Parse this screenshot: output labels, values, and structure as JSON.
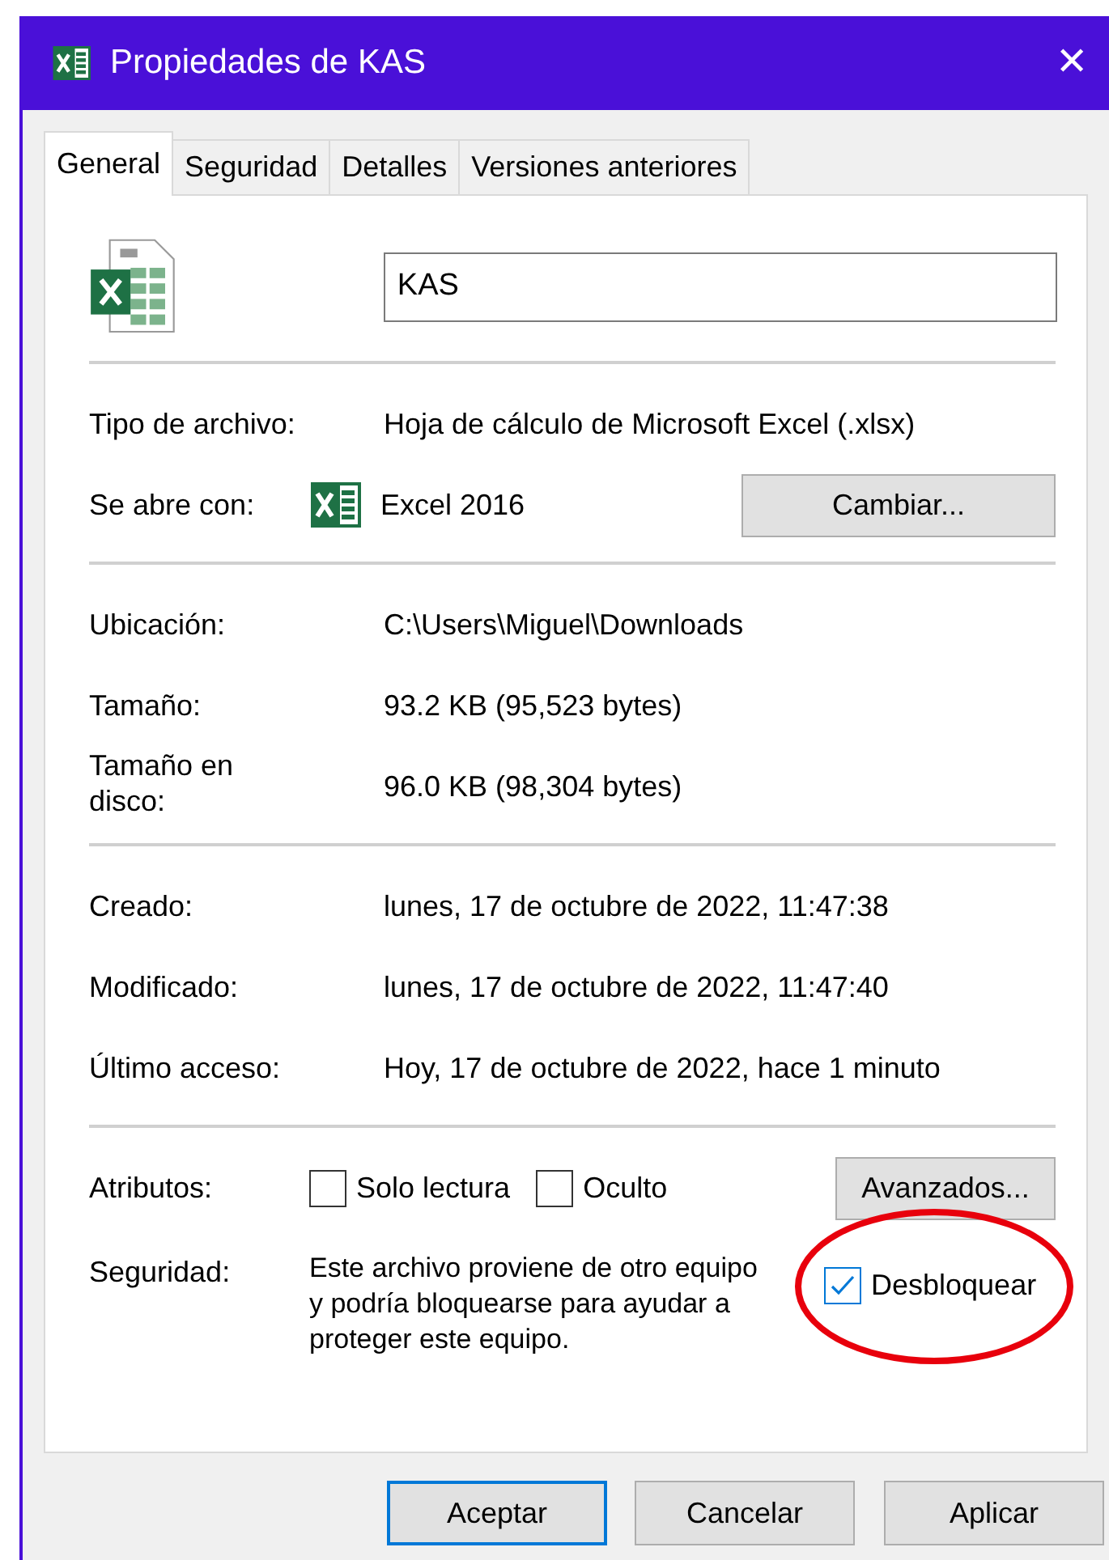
{
  "window": {
    "title": "Propiedades de KAS",
    "close": "✕"
  },
  "tabs": [
    {
      "label": "General",
      "selected": true
    },
    {
      "label": "Seguridad",
      "selected": false
    },
    {
      "label": "Detalles",
      "selected": false
    },
    {
      "label": "Versiones anteriores",
      "selected": false
    }
  ],
  "name_field": {
    "value": "KAS"
  },
  "sections": [
    [
      {
        "kind": "text",
        "label": "Tipo de archivo:",
        "value": "Hoja de cálculo de Microsoft Excel (.xlsx)"
      },
      {
        "kind": "app",
        "label": "Se abre con:",
        "value": "Excel 2016",
        "button": "Cambiar..."
      }
    ],
    [
      {
        "kind": "text",
        "label": "Ubicación:",
        "value": "C:\\Users\\Miguel\\Downloads"
      },
      {
        "kind": "text",
        "label": "Tamaño:",
        "value": "93.2 KB (95,523 bytes)"
      },
      {
        "kind": "text",
        "label": "Tamaño en disco:",
        "value": "96.0 KB (98,304 bytes)"
      }
    ],
    [
      {
        "kind": "text",
        "label": "Creado:",
        "value": "lunes, 17 de octubre de 2022, 11:47:38"
      },
      {
        "kind": "text",
        "label": "Modificado:",
        "value": "lunes, 17 de octubre de 2022, 11:47:40"
      },
      {
        "kind": "text",
        "label": "Último acceso:",
        "value": "Hoy, 17 de octubre de 2022, hace 1 minuto"
      }
    ],
    [
      {
        "kind": "attributes",
        "label": "Atributos:",
        "checkboxes": [
          {
            "label": "Solo lectura",
            "checked": false
          },
          {
            "label": "Oculto",
            "checked": false
          }
        ],
        "button": "Avanzados..."
      },
      {
        "kind": "security",
        "label": "Seguridad:",
        "value": "Este archivo proviene de otro equipo y podría bloquearse para ayudar a proteger este equipo.",
        "checkbox": {
          "label": "Desbloquear",
          "checked": true,
          "circled": true
        }
      }
    ]
  ],
  "buttons": [
    {
      "label": "Aceptar",
      "default": true
    },
    {
      "label": "Cancelar",
      "default": false
    },
    {
      "label": "Aplicar",
      "default": false
    }
  ]
}
